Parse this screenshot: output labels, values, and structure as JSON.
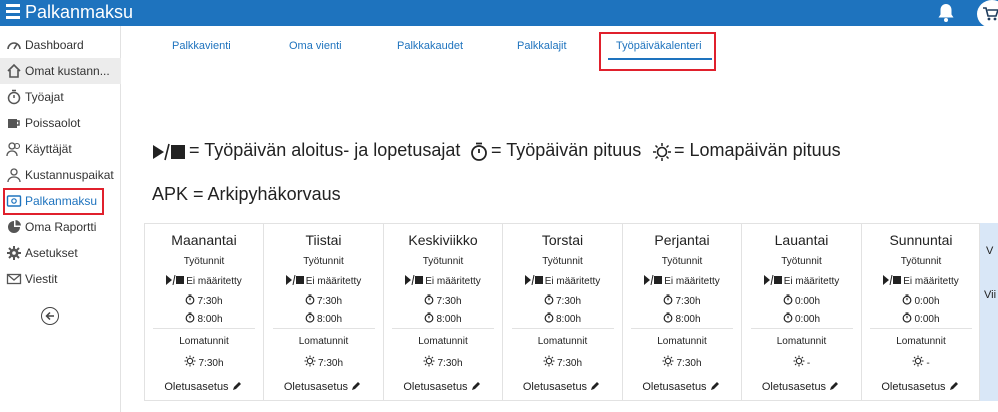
{
  "header": {
    "app_title": "Palkanmaksu",
    "menu_icon": "hamburger-icon",
    "bell_icon": "bell-icon",
    "cart_icon": "cart-icon",
    "color": "#1e73be"
  },
  "sidebar": {
    "items": [
      {
        "label": "Dashboard",
        "icon": "dashboard-icon"
      },
      {
        "label": "Omat kustann...",
        "icon": "home-icon"
      },
      {
        "label": "Työajat",
        "icon": "stopwatch-icon"
      },
      {
        "label": "Poissaolot",
        "icon": "coffee-icon"
      },
      {
        "label": "Käyttäjät",
        "icon": "users-icon"
      },
      {
        "label": "Kustannuspaikat",
        "icon": "person-icon"
      },
      {
        "label": "Palkanmaksu",
        "icon": "payroll-icon"
      },
      {
        "label": "Oma Raportti",
        "icon": "pie-chart-icon"
      },
      {
        "label": "Asetukset",
        "icon": "gear-icon"
      },
      {
        "label": "Viestit",
        "icon": "envelope-icon"
      }
    ],
    "active_item": "Palkanmaksu",
    "back_icon": "back-arrow-icon"
  },
  "tabs": [
    {
      "label": "Palkkavienti"
    },
    {
      "label": "Oma vienti"
    },
    {
      "label": "Palkkakaudet"
    },
    {
      "label": "Palkkalajit"
    },
    {
      "label": "Työpäiväkalenteri"
    }
  ],
  "active_tab": "Työpäiväkalenteri",
  "legend": {
    "start_end": "= Työpäivän aloitus- ja lopetusajat",
    "length": "= Työpäivän pituus",
    "holiday": "= Lomapäivän pituus",
    "apk": "APK = Arkipyhäkorvaus"
  },
  "calendar": {
    "work_hours_label": "Työtunnit",
    "holiday_hours_label": "Lomatunnit",
    "default_label": "Oletusasetus",
    "days": [
      {
        "name": "Maanantai",
        "start_end": "Ei määritetty",
        "length1": "7:30h",
        "length2": "8:00h",
        "holiday": "7:30h"
      },
      {
        "name": "Tiistai",
        "start_end": "Ei määritetty",
        "length1": "7:30h",
        "length2": "8:00h",
        "holiday": "7:30h"
      },
      {
        "name": "Keskiviikko",
        "start_end": "Ei määritetty",
        "length1": "7:30h",
        "length2": "8:00h",
        "holiday": "7:30h"
      },
      {
        "name": "Torstai",
        "start_end": "Ei määritetty",
        "length1": "7:30h",
        "length2": "8:00h",
        "holiday": "7:30h"
      },
      {
        "name": "Perjantai",
        "start_end": "Ei määritetty",
        "length1": "7:30h",
        "length2": "8:00h",
        "holiday": "7:30h"
      },
      {
        "name": "Lauantai",
        "start_end": "Ei määritetty",
        "length1": "0:00h",
        "length2": "0:00h",
        "holiday": "-"
      },
      {
        "name": "Sunnuntai",
        "start_end": "Ei määritetty",
        "length1": "0:00h",
        "length2": "0:00h",
        "holiday": "-"
      }
    ],
    "right_panel": {
      "line1": "V",
      "line2": "Vii"
    }
  }
}
